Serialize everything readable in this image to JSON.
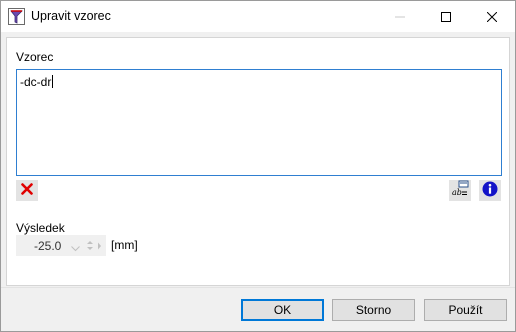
{
  "window": {
    "title": "Upravit vzorec",
    "icon": "formula-app-icon"
  },
  "formula": {
    "label": "Vzorec",
    "value": "-dc-dr"
  },
  "toolbar": {
    "delete_icon": "red-x-icon",
    "function_icon": "ab-function-icon",
    "info_icon": "info-icon"
  },
  "result": {
    "label": "Výsledek",
    "value": "-25.0",
    "unit": "[mm]"
  },
  "buttons": {
    "ok": "OK",
    "cancel": "Storno",
    "apply": "Použít"
  },
  "colors": {
    "focus_border": "#2f7fd1",
    "delete_red": "#e00000",
    "info_blue": "#1414c8"
  }
}
